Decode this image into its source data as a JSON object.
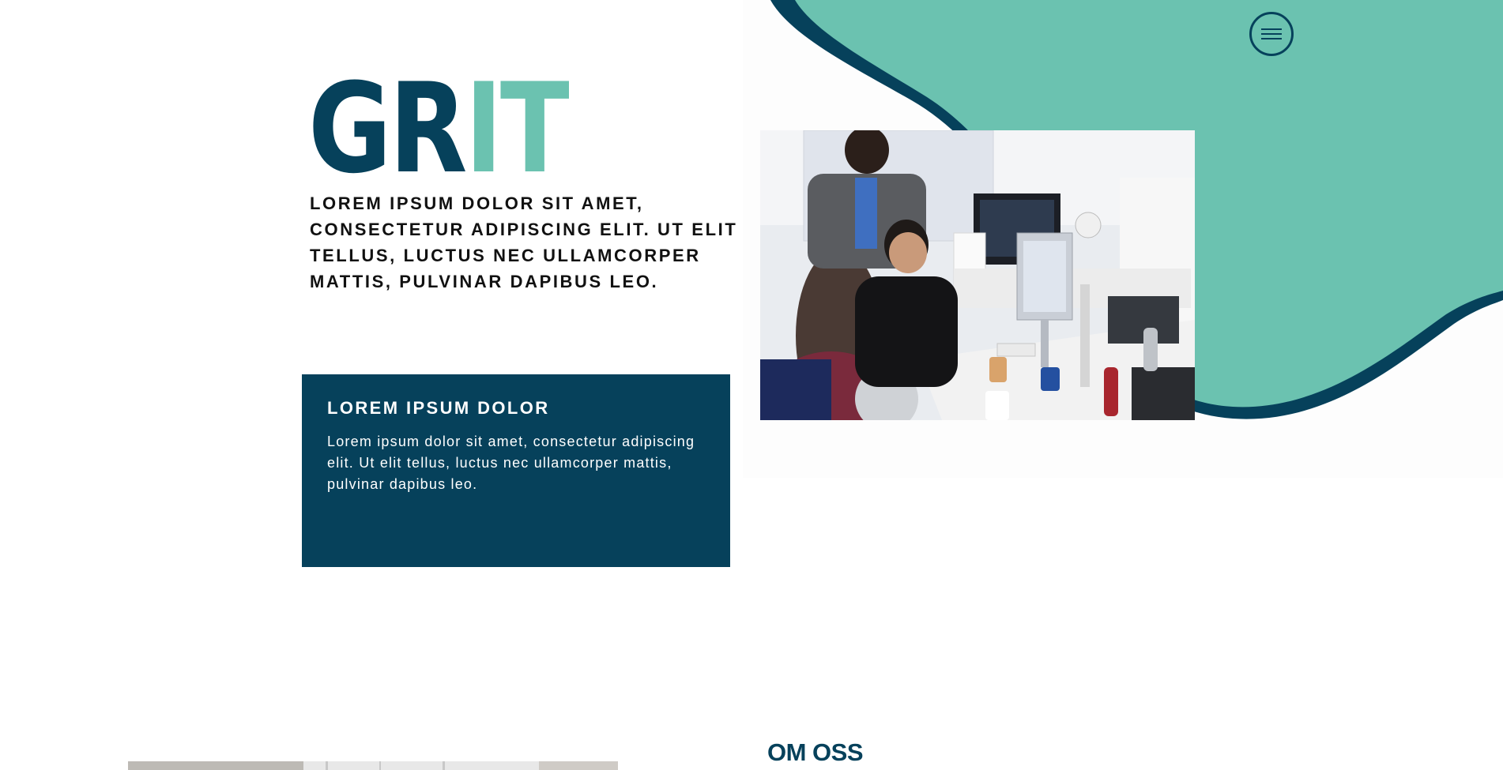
{
  "header": {
    "menu_icon": "hamburger-menu-icon"
  },
  "hero": {
    "logo_part_1": "GR",
    "logo_part_2": "IT",
    "tagline": "LOREM IPSUM DOLOR SIT AMET, CONSECTETUR ADIPISCING ELIT. UT ELIT TELLUS, LUCTUS NEC ULLAMCORPER MATTIS, PULVINAR DAPIBUS LEO.",
    "info_box": {
      "title": "LOREM IPSUM DOLOR",
      "text": "Lorem ipsum dolor sit amet, consectetur adipiscing elit. Ut elit tellus, luctus nec ullamcorper mattis, pulvinar dapibus leo."
    }
  },
  "about": {
    "title": "OM OSS"
  },
  "colors": {
    "primary": "#06415b",
    "accent": "#6bc2b0",
    "text": "#111111",
    "background": "#ffffff"
  }
}
